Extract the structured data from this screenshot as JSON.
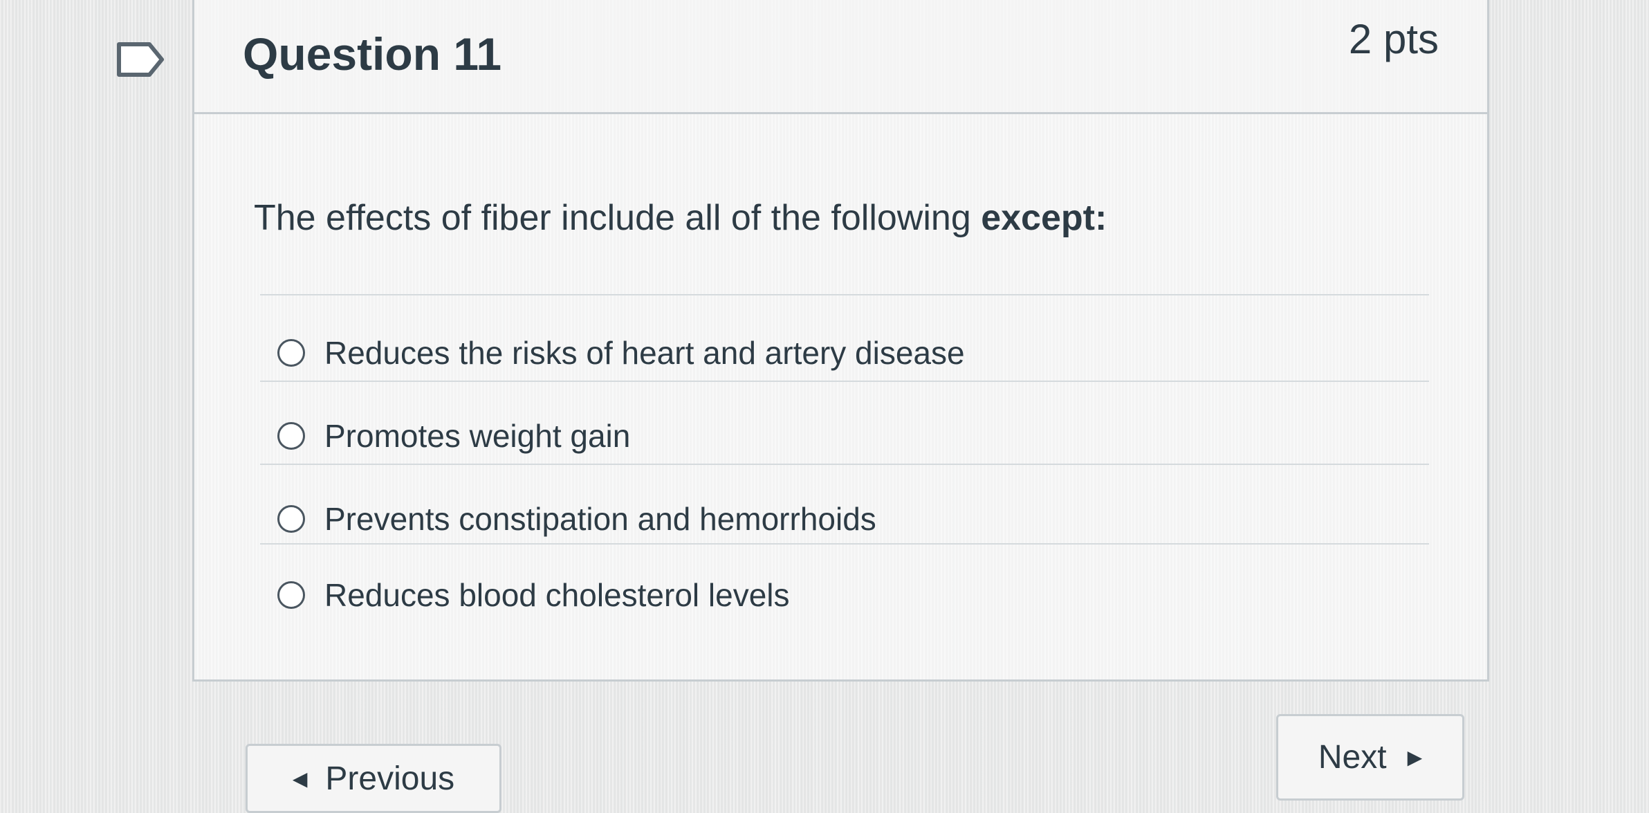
{
  "question": {
    "title": "Question 11",
    "points": "2 pts",
    "text_prefix": "The effects of fiber include all of the following ",
    "text_emphasis": "except:",
    "answers": [
      {
        "label": "Reduces the risks of heart and artery disease",
        "selected": false
      },
      {
        "label": "Promotes weight gain",
        "selected": false
      },
      {
        "label": "Prevents constipation and hemorrhoids",
        "selected": false
      },
      {
        "label": "Reduces blood cholesterol levels",
        "selected": false
      }
    ]
  },
  "navigation": {
    "previous_label": "Previous",
    "next_label": "Next"
  },
  "icons": {
    "flag": "flag-icon",
    "previous_arrow": "triangle-left-icon",
    "next_arrow": "triangle-right-icon"
  },
  "colors": {
    "text": "#2d3b45",
    "border": "#c7cdd1"
  }
}
